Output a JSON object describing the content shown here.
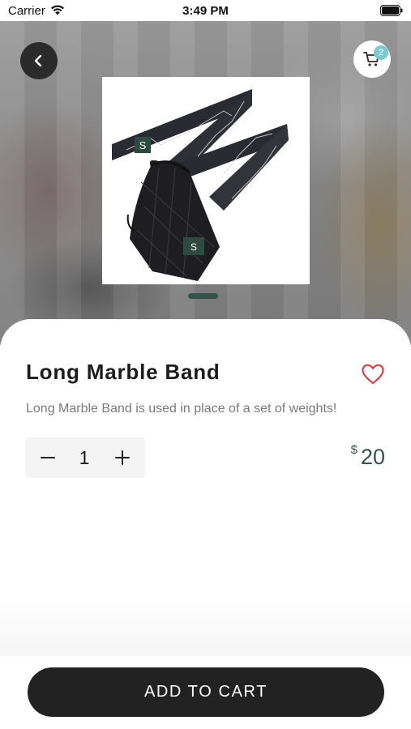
{
  "status_bar": {
    "carrier": "Carrier",
    "time": "3:49 PM",
    "wifi_icon": "wifi-icon",
    "battery_icon": "battery-full-icon"
  },
  "header": {
    "back_icon": "chevron-left-icon",
    "cart_icon": "shopping-cart-icon",
    "cart_count": "2"
  },
  "product": {
    "name": "Long Marble Band",
    "description": "Long Marble Band is used in place of a set of weights!",
    "quantity": "1",
    "price_currency": "$",
    "price_amount": "20",
    "favorite_icon": "heart-outline-icon",
    "carousel_active_index": 1,
    "carousel_total": 1
  },
  "actions": {
    "add_to_cart_label": "ADD TO CART"
  },
  "colors": {
    "brand_dark": "#222222",
    "accent_green": "#34524a",
    "badge_teal": "#7ec9cf",
    "favorite_red": "#d9363e"
  }
}
